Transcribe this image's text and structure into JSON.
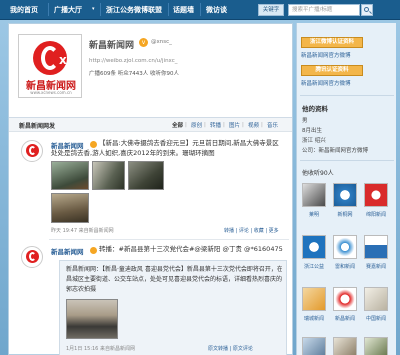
{
  "nav": {
    "items": [
      "我的首页",
      "广播大厅",
      "浙江公务微博联盟",
      "话题墙",
      "微访谈"
    ],
    "has_dropdown_index": 1
  },
  "search": {
    "keyword": "关键字",
    "placeholder": "搜索平广播/标题"
  },
  "profile": {
    "name": "新昌新闻网",
    "handle": "@xnsc_",
    "url": "http://weibo.zjol.com.cn/u/jinxc_",
    "stats": "广播609条   听众7443人   收听你90人",
    "logo_text": "新昌新闻网",
    "logo_url": "www.xcnews.com.cn"
  },
  "feed": {
    "title": "新昌新闻网发",
    "tabs": [
      "全部",
      "原创",
      "转播",
      "图片",
      "视频",
      "音乐"
    ]
  },
  "posts": [
    {
      "author": "新昌新闻网",
      "text1": "【新昌:大佛寺摄鸽去香迎元旦】元旦前日期间,新昌大佛寺景区",
      "text2": "处处是鸽去香,游人如织,喜庆2012年的到来。珊瑚环摘图",
      "time": "昨天 19:47 来自新昌新闻网",
      "actions": "转播 | 评论 | 收藏 | 更多"
    },
    {
      "author": "新昌新闻网",
      "text": "转播：#新昌县第十三次党代会#@梁新阳 @丁贵 @*6160475"
    }
  ],
  "quote": {
    "l1": "新昌新闻网：【新昌·童迪政风 喜迎县党代会】新昌县第十三次党代会即将召开，在新",
    "l2": "昌城区主要街道、公交车站点，处处可见喜迎县党代会的标语，详细看热烈喜庆的氛围。",
    "l3": "郭志农拍摄",
    "time": "1月1日 15:16 来自新昌新闻网",
    "actions": "原文转播 | 原文评论"
  },
  "sidebar": {
    "btn1": "浙江微博认证资料",
    "link1": "新昌新闻网官方微博",
    "btn2": "腾讯认证资料",
    "link2": "新昌新闻网官方微博",
    "info_title": "他的资料",
    "info": [
      "男",
      "8月出生",
      "浙江 绍兴",
      "公司：新昌新闻网官方微博"
    ],
    "follow_title": "他收听90人",
    "tiles": [
      "莱明",
      "新桐网",
      "绵阳新闻",
      "浙江公益",
      "雷和新闻",
      "赛嘉新闻",
      "瑞城新闻",
      "新昌新闻",
      "中国新闻"
    ]
  },
  "colors": {
    "topbar": "#1a5d8e",
    "accent": "#2a5f96",
    "badge": "#f5a623",
    "logo_red": "#e02020",
    "vip_button": "#f3b64a"
  }
}
